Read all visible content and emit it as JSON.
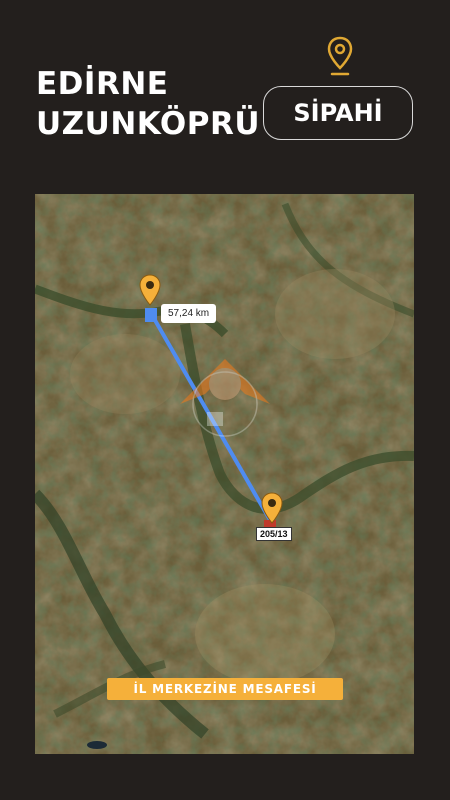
{
  "title": {
    "line1": "EDİRNE",
    "line2": "UZUNKÖPRÜ"
  },
  "location_badge": "SİPAHİ",
  "map": {
    "distance_label": "57,24 km",
    "parcel_label": "205/13",
    "banner": "İL MERKEZİNE MESAFESİ"
  },
  "colors": {
    "background": "#231f1d",
    "pin": "#f5b03a",
    "route": "#4f8cf0",
    "banner": "#f5b03a"
  },
  "icons": [
    "location-pin-icon",
    "map-marker-icon",
    "watermark-logo"
  ]
}
